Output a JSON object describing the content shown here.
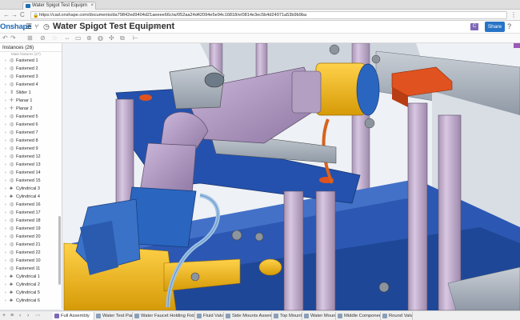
{
  "browser": {
    "tab_title": "Water Spigot Test Equipm",
    "tab_close": "×",
    "url": "https://cad.onshape.com/documents/da79842ed9404d21aeeee66c/w/052aa24d42094e5e94c16818/e/0814e3ec5b4d24071a53b9b9ba",
    "lock": "🔒",
    "back": "←",
    "forward": "→",
    "reload": "C",
    "menu": "⋮"
  },
  "header": {
    "logo": "Onshape",
    "document_title": "Water Spigot Test Equipment",
    "workspace": "Main",
    "avatar_initial": "C",
    "share_label": "Share",
    "help_label": "?"
  },
  "instances": {
    "header": "Instances (26)",
    "subheader": "Mate features (27)",
    "items": [
      {
        "label": "Fastened 1",
        "icon": "fastened-icon"
      },
      {
        "label": "Fastened 2",
        "icon": "fastened-icon"
      },
      {
        "label": "Fastened 3",
        "icon": "fastened-icon"
      },
      {
        "label": "Fastened 4",
        "icon": "fastened-icon"
      },
      {
        "label": "Slider 1",
        "icon": "slider-icon"
      },
      {
        "label": "Planar 1",
        "icon": "planar-icon"
      },
      {
        "label": "Planar 2",
        "icon": "planar-icon"
      },
      {
        "label": "Fastened 5",
        "icon": "fastened-icon"
      },
      {
        "label": "Fastened 6",
        "icon": "fastened-icon"
      },
      {
        "label": "Fastened 7",
        "icon": "fastened-icon"
      },
      {
        "label": "Fastened 8",
        "icon": "fastened-icon"
      },
      {
        "label": "Fastened 9",
        "icon": "fastened-icon"
      },
      {
        "label": "Fastened 12",
        "icon": "fastened-icon"
      },
      {
        "label": "Fastened 13",
        "icon": "fastened-icon"
      },
      {
        "label": "Fastened 14",
        "icon": "fastened-icon"
      },
      {
        "label": "Fastened 15",
        "icon": "fastened-icon"
      },
      {
        "label": "Cylindrical 3",
        "icon": "cylindrical-icon"
      },
      {
        "label": "Cylindrical 4",
        "icon": "cylindrical-icon"
      },
      {
        "label": "Fastened 16",
        "icon": "fastened-icon"
      },
      {
        "label": "Fastened 17",
        "icon": "fastened-icon"
      },
      {
        "label": "Fastened 18",
        "icon": "fastened-icon"
      },
      {
        "label": "Fastened 19",
        "icon": "fastened-icon"
      },
      {
        "label": "Fastened 20",
        "icon": "fastened-icon"
      },
      {
        "label": "Fastened 21",
        "icon": "fastened-icon"
      },
      {
        "label": "Fastened 22",
        "icon": "fastened-icon"
      },
      {
        "label": "Fastened 10",
        "icon": "fastened-icon"
      },
      {
        "label": "Fastened 11",
        "icon": "fastened-icon"
      },
      {
        "label": "Cylindrical 1",
        "icon": "cylindrical-icon"
      },
      {
        "label": "Cylindrical 2",
        "icon": "cylindrical-icon"
      },
      {
        "label": "Cylindrical 5",
        "icon": "cylindrical-icon"
      },
      {
        "label": "Cylindrical 6",
        "icon": "cylindrical-icon"
      }
    ]
  },
  "tabs": [
    {
      "label": "Full Assembly",
      "active": true
    },
    {
      "label": "Water Test Parts",
      "active": false
    },
    {
      "label": "Water Faucet Holding Fixture",
      "active": false
    },
    {
      "label": "Fluid Valve",
      "active": false
    },
    {
      "label": "Side Mounts Assembly",
      "active": false
    },
    {
      "label": "Top Mounts",
      "active": false
    },
    {
      "label": "Water Mount",
      "active": false
    },
    {
      "label": "Middle Components",
      "active": false
    },
    {
      "label": "Round Valv",
      "active": false
    }
  ],
  "colors": {
    "brand": "#1b68b4",
    "share": "#2774c6",
    "avatar": "#7e68b8",
    "frame_purple": "#c9b3d6",
    "base_blue": "#2150a8",
    "accent_yellow": "#f4b516",
    "accent_orange": "#e0521f"
  }
}
